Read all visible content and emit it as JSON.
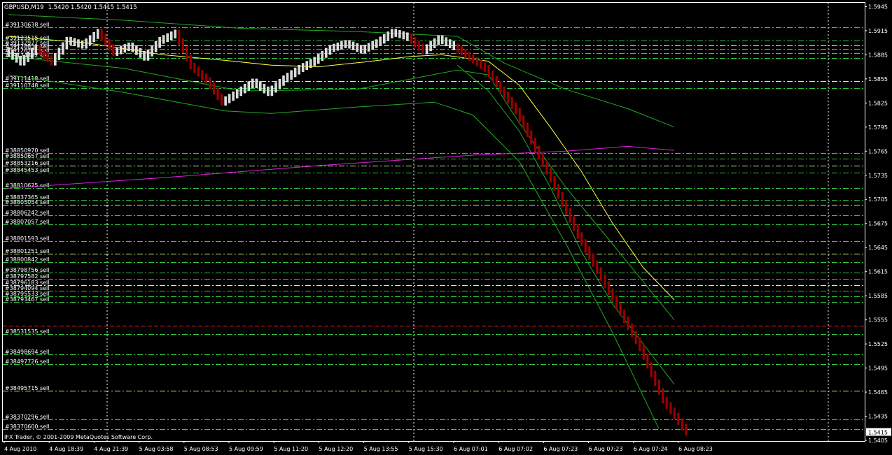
{
  "header": {
    "symbol": "GBPUSD,M19",
    "ohlc": "1.5420 1.5420 1.5415 1.5415"
  },
  "footer": {
    "copyright": "IFX Trader, © 2001-2009 MetaQuotes Software Corp."
  },
  "current_price": "1.5415",
  "colors": {
    "background": "#000000",
    "frame": "#ffffff",
    "bull_candle": "#d8d8d8",
    "bear_candle": "#a00000",
    "order_line": "#2ecc40",
    "order_line_light": "#c8ff80",
    "stop_line": "#ff2020",
    "ma_yellow": "#ffff40",
    "ma_magenta": "#e020e0",
    "envelope": "#22aa22"
  },
  "chart_data": {
    "type": "candlestick",
    "symbol": "GBPUSD",
    "timeframe": "M19",
    "ylim": [
      1.5405,
      1.5948
    ],
    "y_ticks": [
      "1.5945",
      "1.5915",
      "1.5885",
      "1.5855",
      "1.5825",
      "1.5795",
      "1.5765",
      "1.5735",
      "1.5705",
      "1.5675",
      "1.5645",
      "1.5615",
      "1.5585",
      "1.5555",
      "1.5525",
      "1.5495",
      "1.5465",
      "1.5435",
      "1.5405"
    ],
    "x_ticks": [
      "4 Aug 2010",
      "4 Aug 18:39",
      "4 Aug 21:39",
      "5 Aug 03:58",
      "5 Aug 08:53",
      "5 Aug 09:59",
      "5 Aug 11:20",
      "5 Aug 12:20",
      "5 Aug 13:55",
      "5 Aug 15:30",
      "6 Aug 07:01",
      "6 Aug 07:02",
      "6 Aug 07:23",
      "6 Aug 07:23",
      "6 Aug 07:24",
      "6 Aug 08:23"
    ],
    "price_path": [
      [
        0,
        1.589
      ],
      [
        2,
        1.5876
      ],
      [
        4,
        1.5893
      ],
      [
        6,
        1.5876
      ],
      [
        8,
        1.5903
      ],
      [
        10,
        1.5897
      ],
      [
        12,
        1.5913
      ],
      [
        14,
        1.5888
      ],
      [
        16,
        1.5896
      ],
      [
        18,
        1.5882
      ],
      [
        20,
        1.5903
      ],
      [
        22,
        1.5912
      ],
      [
        24,
        1.5871
      ],
      [
        26,
        1.5853
      ],
      [
        28,
        1.5826
      ],
      [
        30,
        1.5838
      ],
      [
        32,
        1.5851
      ],
      [
        34,
        1.5838
      ],
      [
        36,
        1.5855
      ],
      [
        38,
        1.5868
      ],
      [
        40,
        1.5878
      ],
      [
        42,
        1.5893
      ],
      [
        44,
        1.5899
      ],
      [
        46,
        1.5891
      ],
      [
        48,
        1.59
      ],
      [
        50,
        1.5913
      ],
      [
        52,
        1.5907
      ],
      [
        54,
        1.589
      ],
      [
        56,
        1.5905
      ],
      [
        58,
        1.5895
      ],
      [
        62,
        1.5868
      ],
      [
        66,
        1.5815
      ],
      [
        70,
        1.574
      ],
      [
        74,
        1.566
      ],
      [
        78,
        1.559
      ],
      [
        82,
        1.552
      ],
      [
        85,
        1.5455
      ],
      [
        88,
        1.5415
      ]
    ],
    "bearish_from_index": 58,
    "current_price": 1.5415,
    "order_lines": [
      {
        "label": "#39130638 sell",
        "price": 1.5919,
        "style": "dash-dot"
      },
      {
        "label": "#39123515 sell",
        "price": 1.5903,
        "style": "dash-dot"
      },
      {
        "label": "#39132977 sell",
        "price": 1.5897,
        "style": "dash-dot"
      },
      {
        "label": "#39128851 sell",
        "price": 1.5892,
        "style": "dash-dot"
      },
      {
        "label": "#39126771 sell",
        "price": 1.5887,
        "style": "dash-dot"
      },
      {
        "label": "#39174382 sell",
        "price": 1.5881,
        "style": "dash-dot"
      },
      {
        "label": "#39111418 sell",
        "price": 1.5852,
        "style": "dash-dot"
      },
      {
        "label": "#39110748 sell",
        "price": 1.5844,
        "style": "dash-dot"
      },
      {
        "label": "#38850970 sell",
        "price": 1.5763,
        "style": "dash-dot"
      },
      {
        "label": "#38850657 sell",
        "price": 1.5756,
        "style": "dash-dot"
      },
      {
        "label": "#38853216 sell",
        "price": 1.5747,
        "style": "dash-dot"
      },
      {
        "label": "#38845453 sell",
        "price": 1.5738,
        "style": "dash-dot"
      },
      {
        "label": "#38810625 sell",
        "price": 1.5719,
        "style": "dash-dot"
      },
      {
        "label": "#38837365 sell",
        "price": 1.5704,
        "style": "dash-dot"
      },
      {
        "label": "#38805054 sell",
        "price": 1.5698,
        "style": "dash-dot"
      },
      {
        "label": "#38806242 sell",
        "price": 1.5685,
        "style": "dash-dot"
      },
      {
        "label": "#38807057 sell",
        "price": 1.5674,
        "style": "dash-dot"
      },
      {
        "label": "#38801593 sell",
        "price": 1.5653,
        "style": "dash-dot"
      },
      {
        "label": "#38801251 sell",
        "price": 1.5637,
        "style": "dash-dot"
      },
      {
        "label": "#38800842 sell",
        "price": 1.5627,
        "style": "dash-dot"
      },
      {
        "label": "#38798756 sell",
        "price": 1.5614,
        "style": "dash-dot"
      },
      {
        "label": "#38797582 sell",
        "price": 1.5606,
        "style": "dash-dot"
      },
      {
        "label": "#38796183 sell",
        "price": 1.5598,
        "style": "dash-dot"
      },
      {
        "label": "#38794094 sell",
        "price": 1.5591,
        "style": "dash-dot"
      },
      {
        "label": "#38795533 sell",
        "price": 1.5584,
        "style": "dash-dot"
      },
      {
        "label": "#38793467 sell",
        "price": 1.5577,
        "style": "dash-dot"
      },
      {
        "label": "",
        "price": 1.5548,
        "style": "stop"
      },
      {
        "label": "#38531535 sell",
        "price": 1.5537,
        "style": "dash-dot"
      },
      {
        "label": "#38498694 sell",
        "price": 1.5512,
        "style": "dash-dot"
      },
      {
        "label": "#38497726 sell",
        "price": 1.55,
        "style": "dash-dot"
      },
      {
        "label": "#38495715 sell",
        "price": 1.5467,
        "style": "dash-dot"
      },
      {
        "label": "#38370296 sell",
        "price": 1.5431,
        "style": "dash-dot"
      },
      {
        "label": "#38370600 sell",
        "price": 1.5419,
        "style": "dash-dot"
      }
    ],
    "indicators": [
      {
        "name": "ma_yellow",
        "color": "#ffff40",
        "points": [
          [
            0,
            1.5908
          ],
          [
            10,
            1.59
          ],
          [
            20,
            1.5885
          ],
          [
            28,
            1.5878
          ],
          [
            34,
            1.5872
          ],
          [
            40,
            1.587
          ],
          [
            46,
            1.5876
          ],
          [
            52,
            1.5883
          ],
          [
            56,
            1.5885
          ],
          [
            62,
            1.5877
          ],
          [
            66,
            1.5847
          ],
          [
            70,
            1.5795
          ],
          [
            74,
            1.574
          ],
          [
            78,
            1.5676
          ],
          [
            82,
            1.562
          ],
          [
            86,
            1.558
          ]
        ]
      },
      {
        "name": "ma_magenta",
        "color": "#e020e0",
        "points": [
          [
            0,
            1.5719
          ],
          [
            20,
            1.5732
          ],
          [
            40,
            1.5747
          ],
          [
            60,
            1.576
          ],
          [
            72,
            1.5765
          ],
          [
            80,
            1.5771
          ],
          [
            86,
            1.5766
          ]
        ]
      },
      {
        "name": "env_upper",
        "color": "#22aa22",
        "points": [
          [
            0,
            1.5935
          ],
          [
            15,
            1.5928
          ],
          [
            30,
            1.5918
          ],
          [
            45,
            1.5914
          ],
          [
            58,
            1.5908
          ],
          [
            64,
            1.5875
          ],
          [
            72,
            1.5842
          ],
          [
            80,
            1.5818
          ],
          [
            86,
            1.5795
          ]
        ]
      },
      {
        "name": "env_mid",
        "color": "#22aa22",
        "points": [
          [
            0,
            1.5883
          ],
          [
            15,
            1.5868
          ],
          [
            30,
            1.584
          ],
          [
            45,
            1.5842
          ],
          [
            58,
            1.5866
          ],
          [
            62,
            1.586
          ],
          [
            66,
            1.58
          ],
          [
            72,
            1.572
          ],
          [
            78,
            1.565
          ],
          [
            86,
            1.5555
          ]
        ]
      },
      {
        "name": "env_lower",
        "color": "#22aa22",
        "points": [
          [
            0,
            1.586
          ],
          [
            15,
            1.5838
          ],
          [
            28,
            1.5815
          ],
          [
            34,
            1.5812
          ],
          [
            45,
            1.582
          ],
          [
            55,
            1.5826
          ],
          [
            60,
            1.581
          ],
          [
            66,
            1.5752
          ],
          [
            72,
            1.565
          ],
          [
            78,
            1.554
          ],
          [
            84,
            1.542
          ]
        ]
      },
      {
        "name": "env_fast",
        "color": "#22aa22",
        "points": [
          [
            58,
            1.5872
          ],
          [
            62,
            1.584
          ],
          [
            66,
            1.579
          ],
          [
            70,
            1.572
          ],
          [
            74,
            1.564
          ],
          [
            78,
            1.5575
          ],
          [
            82,
            1.5525
          ],
          [
            86,
            1.5475
          ]
        ]
      }
    ]
  }
}
